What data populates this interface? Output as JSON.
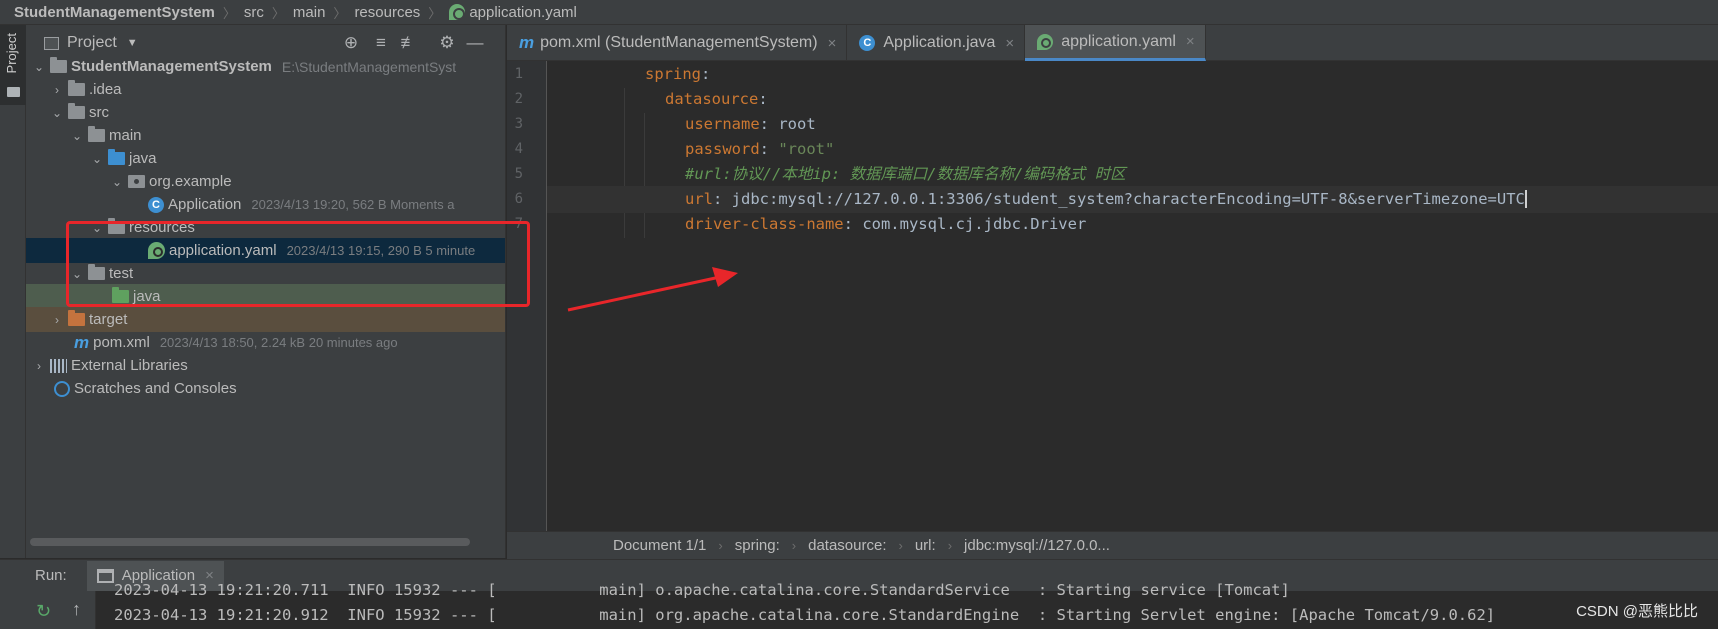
{
  "breadcrumb": {
    "project": "StudentManagementSystem",
    "items": [
      "src",
      "main",
      "resources",
      "application.yaml"
    ]
  },
  "toolstrip": {
    "project_label": "Project"
  },
  "project_panel": {
    "title": "Project",
    "tree": [
      {
        "label": "StudentManagementSystem",
        "meta": "E:\\StudentManagementSyst",
        "arrow": "⌄",
        "icon": "module-folder-icon"
      },
      {
        "label": ".idea",
        "meta": "",
        "arrow": "›",
        "icon": "folder-icon"
      },
      {
        "label": "src",
        "meta": "",
        "arrow": "⌄",
        "icon": "folder-icon"
      },
      {
        "label": "main",
        "meta": "",
        "arrow": "⌄",
        "icon": "folder-icon"
      },
      {
        "label": "java",
        "meta": "",
        "arrow": "⌄",
        "icon": "source-folder-icon"
      },
      {
        "label": "org.example",
        "meta": "",
        "arrow": "⌄",
        "icon": "package-icon"
      },
      {
        "label": "Application",
        "meta": "2023/4/13 19:20, 562 B Moments a",
        "arrow": "",
        "icon": "java-class-icon"
      },
      {
        "label": "resources",
        "meta": "",
        "arrow": "⌄",
        "icon": "resources-folder-icon"
      },
      {
        "label": "application.yaml",
        "meta": "2023/4/13 19:15, 290 B 5 minute",
        "arrow": "",
        "icon": "spring-yaml-icon"
      },
      {
        "label": "test",
        "meta": "",
        "arrow": "⌄",
        "icon": "folder-icon"
      },
      {
        "label": "java",
        "meta": "",
        "arrow": "",
        "icon": "test-folder-icon"
      },
      {
        "label": "target",
        "meta": "",
        "arrow": "›",
        "icon": "excluded-folder-icon"
      },
      {
        "label": "pom.xml",
        "meta": "2023/4/13 18:50, 2.24 kB 20 minutes ago",
        "arrow": "",
        "icon": "maven-icon"
      },
      {
        "label": "External Libraries",
        "meta": "",
        "arrow": "›",
        "icon": "library-icon"
      },
      {
        "label": "Scratches and Consoles",
        "meta": "",
        "arrow": "",
        "icon": "scratch-icon"
      }
    ]
  },
  "tabs": [
    {
      "label": "pom.xml (StudentManagementSystem)",
      "icon": "maven-icon",
      "active": false
    },
    {
      "label": "Application.java",
      "icon": "java-class-icon",
      "active": false
    },
    {
      "label": "application.yaml",
      "icon": "spring-yaml-icon",
      "active": true
    }
  ],
  "editor": {
    "line_numbers": [
      "1",
      "2",
      "3",
      "4",
      "5",
      "6",
      "7"
    ],
    "lines": {
      "l1_key": "spring",
      "l2_key": "datasource",
      "l3_key": "username",
      "l3_val": "root",
      "l4_key": "password",
      "l4_val": "\"root\"",
      "l5_comment": "#url:协议//本地ip: 数据库端口/数据库名称/编码格式 时区",
      "l6_key": "url",
      "l6_val": "jdbc:mysql://127.0.0.1:3306/student_system?characterEncoding=UTF-8&serverTimezone=UTC",
      "l7_key": "driver-class-name",
      "l7_val": "com.mysql.cj.jdbc.Driver"
    }
  },
  "editor_crumbs": [
    "Document 1/1",
    "spring:",
    "datasource:",
    "url:",
    "jdbc:mysql://127.0.0..."
  ],
  "run": {
    "label": "Run:",
    "tab": "Application"
  },
  "console": {
    "line1": "2023-04-13 19:21:20.711  INFO 15932 --- [           main] o.apache.catalina.core.StandardService   : Starting service [Tomcat]",
    "line2": "2023-04-13 19:21:20.912  INFO 15932 --- [           main] org.apache.catalina.core.StandardEngine  : Starting Servlet engine: [Apache Tomcat/9.0.62]"
  },
  "watermark": "CSDN @恶熊比比",
  "colors": {
    "annotation": "#e8262a",
    "selection": "#0d293e",
    "accent": "#4a88c7"
  }
}
